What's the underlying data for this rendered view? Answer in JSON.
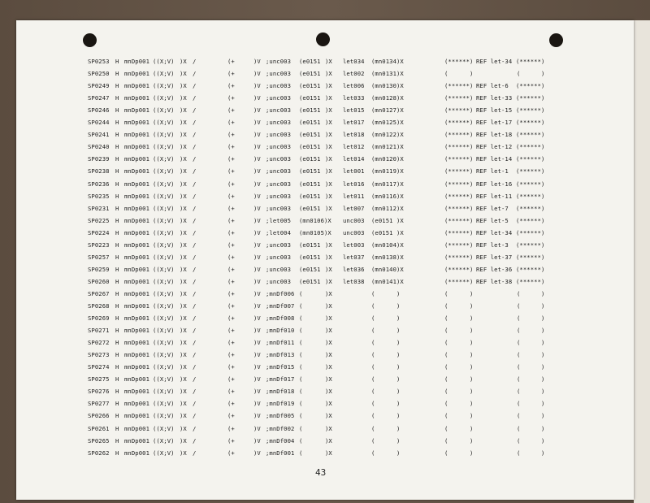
{
  "page_number": "43",
  "rows": [
    [
      "SP0253",
      "H",
      "mnDp001",
      "((X;V)",
      ")X",
      "/",
      "(+",
      ")V",
      ";unc003",
      "(e0151",
      ")X",
      "let034",
      "(mn0134)X",
      "(******)",
      "REF let-34",
      "(******)"
    ],
    [
      "SP0250",
      "H",
      "mnDp001",
      "((X;V)",
      ")X",
      "/",
      "(+",
      ")V",
      ";unc003",
      "(e0151",
      ")X",
      "let002",
      "(mn0131)X",
      "(",
      ")",
      "(",
      ")"
    ],
    [
      "SP0249",
      "H",
      "mnDp001",
      "((X;V)",
      ")X",
      "/",
      "(+",
      ")V",
      ";unc003",
      "(e0151",
      ")X",
      "let006",
      "(mn0130)X",
      "(******)",
      "REF let-6",
      "(******)"
    ],
    [
      "SP0247",
      "H",
      "mnDp001",
      "((X;V)",
      ")X",
      "/",
      "(+",
      ")V",
      ";unc003",
      "(e0151",
      ")X",
      "let033",
      "(mn0128)X",
      "(******)",
      "REF let-33",
      "(******)"
    ],
    [
      "SP0246",
      "H",
      "mnDp001",
      "((X;V)",
      ")X",
      "/",
      "(+",
      ")V",
      ";unc003",
      "(e0151",
      ")X",
      "let015",
      "(mn0127)X",
      "(******)",
      "REF let-15",
      "(******)"
    ],
    [
      "SP0244",
      "H",
      "mnDp001",
      "((X;V)",
      ")X",
      "/",
      "(+",
      ")V",
      ";unc003",
      "(e0151",
      ")X",
      "let017",
      "(mn0125)X",
      "(******)",
      "REF let-17",
      "(******)"
    ],
    [
      "SP0241",
      "H",
      "mnDp001",
      "((X;V)",
      ")X",
      "/",
      "(+",
      ")V",
      ";unc003",
      "(e0151",
      ")X",
      "let018",
      "(mn0122)X",
      "(******)",
      "REF let-18",
      "(******)"
    ],
    [
      "SP0240",
      "H",
      "mnDp001",
      "((X;V)",
      ")X",
      "/",
      "(+",
      ")V",
      ";unc003",
      "(e0151",
      ")X",
      "let012",
      "(mn0121)X",
      "(******)",
      "REF let-12",
      "(******)"
    ],
    [
      "SP0239",
      "H",
      "mnDp001",
      "((X;V)",
      ")X",
      "/",
      "(+",
      ")V",
      ";unc003",
      "(e0151",
      ")X",
      "let014",
      "(mn0120)X",
      "(******)",
      "REF let-14",
      "(******)"
    ],
    [
      "SP0238",
      "H",
      "mnDp001",
      "((X;V)",
      ")X",
      "/",
      "(+",
      ")V",
      ";unc003",
      "(e0151",
      ")X",
      "let001",
      "(mn0119)X",
      "(******)",
      "REF let-1",
      "(******)"
    ],
    [
      "SP0236",
      "H",
      "mnDp001",
      "((X;V)",
      ")X",
      "/",
      "(+",
      ")V",
      ";unc003",
      "(e0151",
      ")X",
      "let016",
      "(mn0117)X",
      "(******)",
      "REF let-16",
      "(******)"
    ],
    [
      "SP0235",
      "H",
      "mnDp001",
      "((X;V)",
      ")X",
      "/",
      "(+",
      ")V",
      ";unc003",
      "(e0151",
      ")X",
      "let011",
      "(mn0116)X",
      "(******)",
      "REF let-11",
      "(******)"
    ],
    [
      "SP0231",
      "H",
      "mnDp001",
      "((X;V)",
      ")X",
      "/",
      "(+",
      ")V",
      ";unc003",
      "(e0151",
      ")X",
      "let007",
      "(mn0112)X",
      "(******)",
      "REF let-7",
      "(******)"
    ],
    [
      "SP0225",
      "H",
      "mnDp001",
      "((X;V)",
      ")X",
      "/",
      "(+",
      ")V",
      ";let005",
      "(mn0106)X",
      "",
      "unc003",
      "(e0151 )X",
      "(******)",
      "REF let-5",
      "(******)"
    ],
    [
      "SP0224",
      "H",
      "mnDp001",
      "((X;V)",
      ")X",
      "/",
      "(+",
      ")V",
      ";let004",
      "(mn0105)X",
      "",
      "unc003",
      "(e0151 )X",
      "(******)",
      "REF let-34",
      "(******)"
    ],
    [
      "SP0223",
      "H",
      "mnDp001",
      "((X;V)",
      ")X",
      "/",
      "(+",
      ")V",
      ";unc003",
      "(e0151",
      ")X",
      "let003",
      "(mn0104)X",
      "(******)",
      "REF let-3",
      "(******)"
    ],
    [
      "SP0257",
      "H",
      "mnDp001",
      "((X;V)",
      ")X",
      "/",
      "(+",
      ")V",
      ";unc003",
      "(e0151",
      ")X",
      "let037",
      "(mn0138)X",
      "(******)",
      "REF let-37",
      "(******)"
    ],
    [
      "SP0259",
      "H",
      "mnDp001",
      "((X;V)",
      ")X",
      "/",
      "(+",
      ")V",
      ";unc003",
      "(e0151",
      ")X",
      "let036",
      "(mn0140)X",
      "(******)",
      "REF let-36",
      "(******)"
    ],
    [
      "SP0260",
      "H",
      "mnDp001",
      "((X;V)",
      ")X",
      "/",
      "(+",
      ")V",
      ";unc003",
      "(e0151",
      ")X",
      "let038",
      "(mn0141)X",
      "(******)",
      "REF let-38",
      "(******)"
    ],
    [
      "SP0267",
      "H",
      "mnDp001",
      "((X;V)",
      ")X",
      "/",
      "(+",
      ")V",
      ";mnDf006",
      "(",
      ")X",
      "",
      "(      )",
      "(",
      ")",
      "(",
      ")"
    ],
    [
      "SP0268",
      "H",
      "mnDp001",
      "((X;V)",
      ")X",
      "/",
      "(+",
      ")V",
      ";mnDf007",
      "(",
      ")X",
      "",
      "(      )",
      "(",
      ")",
      "(",
      ")"
    ],
    [
      "SP0269",
      "H",
      "mnDp001",
      "((X;V)",
      ")X",
      "/",
      "(+",
      ")V",
      ";mnDf008",
      "(",
      ")X",
      "",
      "(      )",
      "(",
      ")",
      "(",
      ")"
    ],
    [
      "SP0271",
      "H",
      "mnDp001",
      "((X;V)",
      ")X",
      "/",
      "(+",
      ")V",
      ";mnDf010",
      "(",
      ")X",
      "",
      "(      )",
      "(",
      ")",
      "(",
      ")"
    ],
    [
      "SP0272",
      "H",
      "mnDp001",
      "((X;V)",
      ")X",
      "/",
      "(+",
      ")V",
      ";mnDf011",
      "(",
      ")X",
      "",
      "(      )",
      "(",
      ")",
      "(",
      ")"
    ],
    [
      "SP0273",
      "H",
      "mnDp001",
      "((X;V)",
      ")X",
      "/",
      "(+",
      ")V",
      ";mnDf013",
      "(",
      ")X",
      "",
      "(      )",
      "(",
      ")",
      "(",
      ")"
    ],
    [
      "SP0274",
      "H",
      "mnDp001",
      "((X;V)",
      ")X",
      "/",
      "(+",
      ")V",
      ";mnDf015",
      "(",
      ")X",
      "",
      "(      )",
      "(",
      ")",
      "(",
      ")"
    ],
    [
      "SP0275",
      "H",
      "mnDp001",
      "((X;V)",
      ")X",
      "/",
      "(+",
      ")V",
      ";mnDf017",
      "(",
      ")X",
      "",
      "(      )",
      "(",
      ")",
      "(",
      ")"
    ],
    [
      "SP0276",
      "H",
      "mnDp001",
      "((X;V)",
      ")X",
      "/",
      "(+",
      ")V",
      ";mnDf018",
      "(",
      ")X",
      "",
      "(      )",
      "(",
      ")",
      "(",
      ")"
    ],
    [
      "SP0277",
      "H",
      "mnDp001",
      "((X;V)",
      ")X",
      "/",
      "(+",
      ")V",
      ";mnDf019",
      "(",
      ")X",
      "",
      "(      )",
      "(",
      ")",
      "(",
      ")"
    ],
    [
      "SP0266",
      "H",
      "mnDp001",
      "((X;V)",
      ")X",
      "/",
      "(+",
      ")V",
      ";mnDf005",
      "(",
      ")X",
      "",
      "(      )",
      "(",
      ")",
      "(",
      ")"
    ],
    [
      "SP0261",
      "H",
      "mnDp001",
      "((X;V)",
      ")X",
      "/",
      "(+",
      ")V",
      ";mnDf002",
      "(",
      ")X",
      "",
      "(      )",
      "(",
      ")",
      "(",
      ")"
    ],
    [
      "SP0265",
      "H",
      "mnDp001",
      "((X;V)",
      ")X",
      "/",
      "(+",
      ")V",
      ";mnDf004",
      "(",
      ")X",
      "",
      "(      )",
      "(",
      ")",
      "(",
      ")"
    ],
    [
      "SP0262",
      "H",
      "mnDp001",
      "((X;V)",
      ")X",
      "/",
      "(+",
      ")V",
      ";mnDf001",
      "(",
      ")X",
      "",
      "(      )",
      "(",
      ")",
      "(",
      ")"
    ]
  ]
}
